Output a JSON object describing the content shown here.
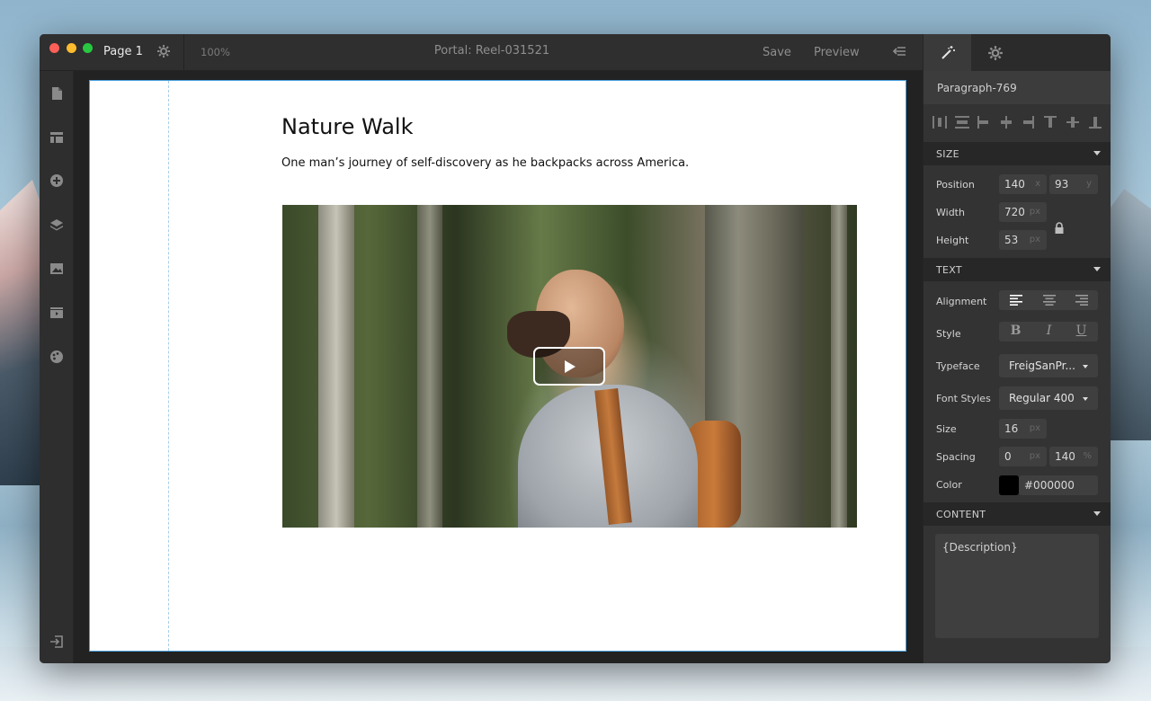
{
  "window": {
    "page_name": "Page 1",
    "zoom": "100%",
    "document_title": "Portal: Reel-031521",
    "save_label": "Save",
    "preview_label": "Preview"
  },
  "left_toolbar": {
    "icons": [
      "page-icon",
      "layout-icon",
      "add-icon",
      "layers-icon",
      "image-icon",
      "media-icon",
      "theme-icon",
      "exit-icon"
    ]
  },
  "canvas": {
    "heading": "Nature Walk",
    "description": "One man’s journey of self-discovery as he backpacks across America.",
    "video": {
      "alt": "Man with beard and backpack looking up in forest",
      "play_icon": "play-icon"
    },
    "element_toolbar": [
      "add-icon",
      "move-up-icon",
      "move-down-icon",
      "delete-icon"
    ]
  },
  "inspector": {
    "tabs": [
      "magic-wand-icon",
      "gear-icon"
    ],
    "element_name": "Paragraph-769",
    "size": {
      "header": "SIZE",
      "position_label": "Position",
      "position_x": "140",
      "position_x_unit": "x",
      "position_y": "93",
      "position_y_unit": "y",
      "width_label": "Width",
      "width_value": "720",
      "width_unit": "px",
      "height_label": "Height",
      "height_value": "53",
      "height_unit": "px"
    },
    "text": {
      "header": "TEXT",
      "alignment_label": "Alignment",
      "style_label": "Style",
      "bold": "B",
      "italic": "I",
      "underline": "U",
      "typeface_label": "Typeface",
      "typeface_value": "FreigSanPr...",
      "font_styles_label": "Font Styles",
      "font_styles_value": "Regular 400",
      "size_label": "Size",
      "size_value": "16",
      "size_unit": "px",
      "spacing_label": "Spacing",
      "letter_spacing": "0",
      "letter_spacing_unit": "px",
      "line_height": "140",
      "line_height_unit": "%",
      "color_label": "Color",
      "color_value": "#000000"
    },
    "content": {
      "header": "CONTENT",
      "value": "{Description}"
    }
  },
  "colors": {
    "selection_blue": "#4aa3e0",
    "panel_bg": "#333333",
    "field_bg": "#3f3f3f"
  }
}
